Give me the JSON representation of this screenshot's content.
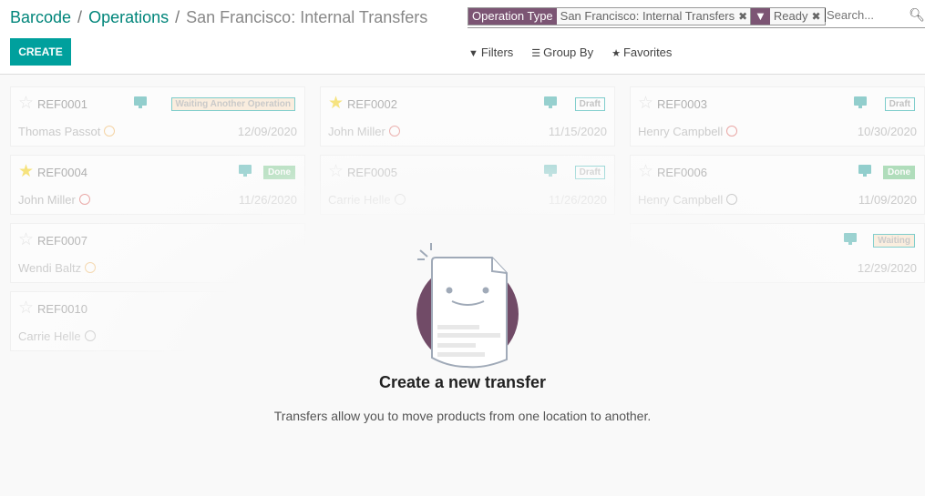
{
  "breadcrumb": {
    "items": [
      "Barcode",
      "Operations"
    ],
    "current": "San Francisco: Internal Transfers",
    "separator": "/"
  },
  "toolbar": {
    "create_label": "CREATE",
    "filters": "Filters",
    "group_by": "Group By",
    "favorites": "Favorites"
  },
  "search": {
    "facets": [
      {
        "label": "Operation Type",
        "value": "San Francisco: Internal Transfers"
      },
      {
        "icon": "filter-icon",
        "value": "Ready"
      }
    ],
    "placeholder": "Search...",
    "value": ""
  },
  "colors": {
    "accent": "#00a09d",
    "brand": "#7c5574"
  },
  "cards": [
    {
      "ref": "REF0001",
      "starred": false,
      "status": "Waiting Another Operation",
      "status_type": "wait",
      "contact": "Thomas Passot",
      "clock": "orange",
      "date": "12/09/2020"
    },
    {
      "ref": "REF0002",
      "starred": true,
      "status": "Draft",
      "status_type": "draft",
      "contact": "John Miller",
      "clock": "red",
      "date": "11/15/2020"
    },
    {
      "ref": "REF0003",
      "starred": false,
      "status": "Draft",
      "status_type": "draft",
      "contact": "Henry Campbell",
      "clock": "red",
      "date": "10/30/2020"
    },
    {
      "ref": "REF0004",
      "starred": true,
      "status": "Done",
      "status_type": "done",
      "contact": "John Miller",
      "clock": "red",
      "date": "11/26/2020"
    },
    {
      "ref": "REF0005",
      "starred": false,
      "status": "Draft",
      "status_type": "draft",
      "contact": "Carrie Helle",
      "clock": "grey",
      "date": "11/26/2020"
    },
    {
      "ref": "REF0006",
      "starred": false,
      "status": "Done",
      "status_type": "done",
      "contact": "Henry Campbell",
      "clock": "grey",
      "date": "11/09/2020"
    },
    {
      "ref": "REF0007",
      "starred": false,
      "status": "",
      "status_type": "",
      "contact": "Wendi Baltz",
      "clock": "orange",
      "date": ""
    },
    null,
    {
      "ref": "",
      "starred": null,
      "status": "Waiting",
      "status_type": "wait",
      "contact": "",
      "clock": "",
      "date": "12/29/2020"
    },
    {
      "ref": "REF0010",
      "starred": false,
      "status": "",
      "status_type": "",
      "contact": "Carrie Helle",
      "clock": "grey",
      "date": ""
    }
  ],
  "empty_state": {
    "title": "Create a new transfer",
    "text": "Transfers allow you to move products from one location to another."
  }
}
